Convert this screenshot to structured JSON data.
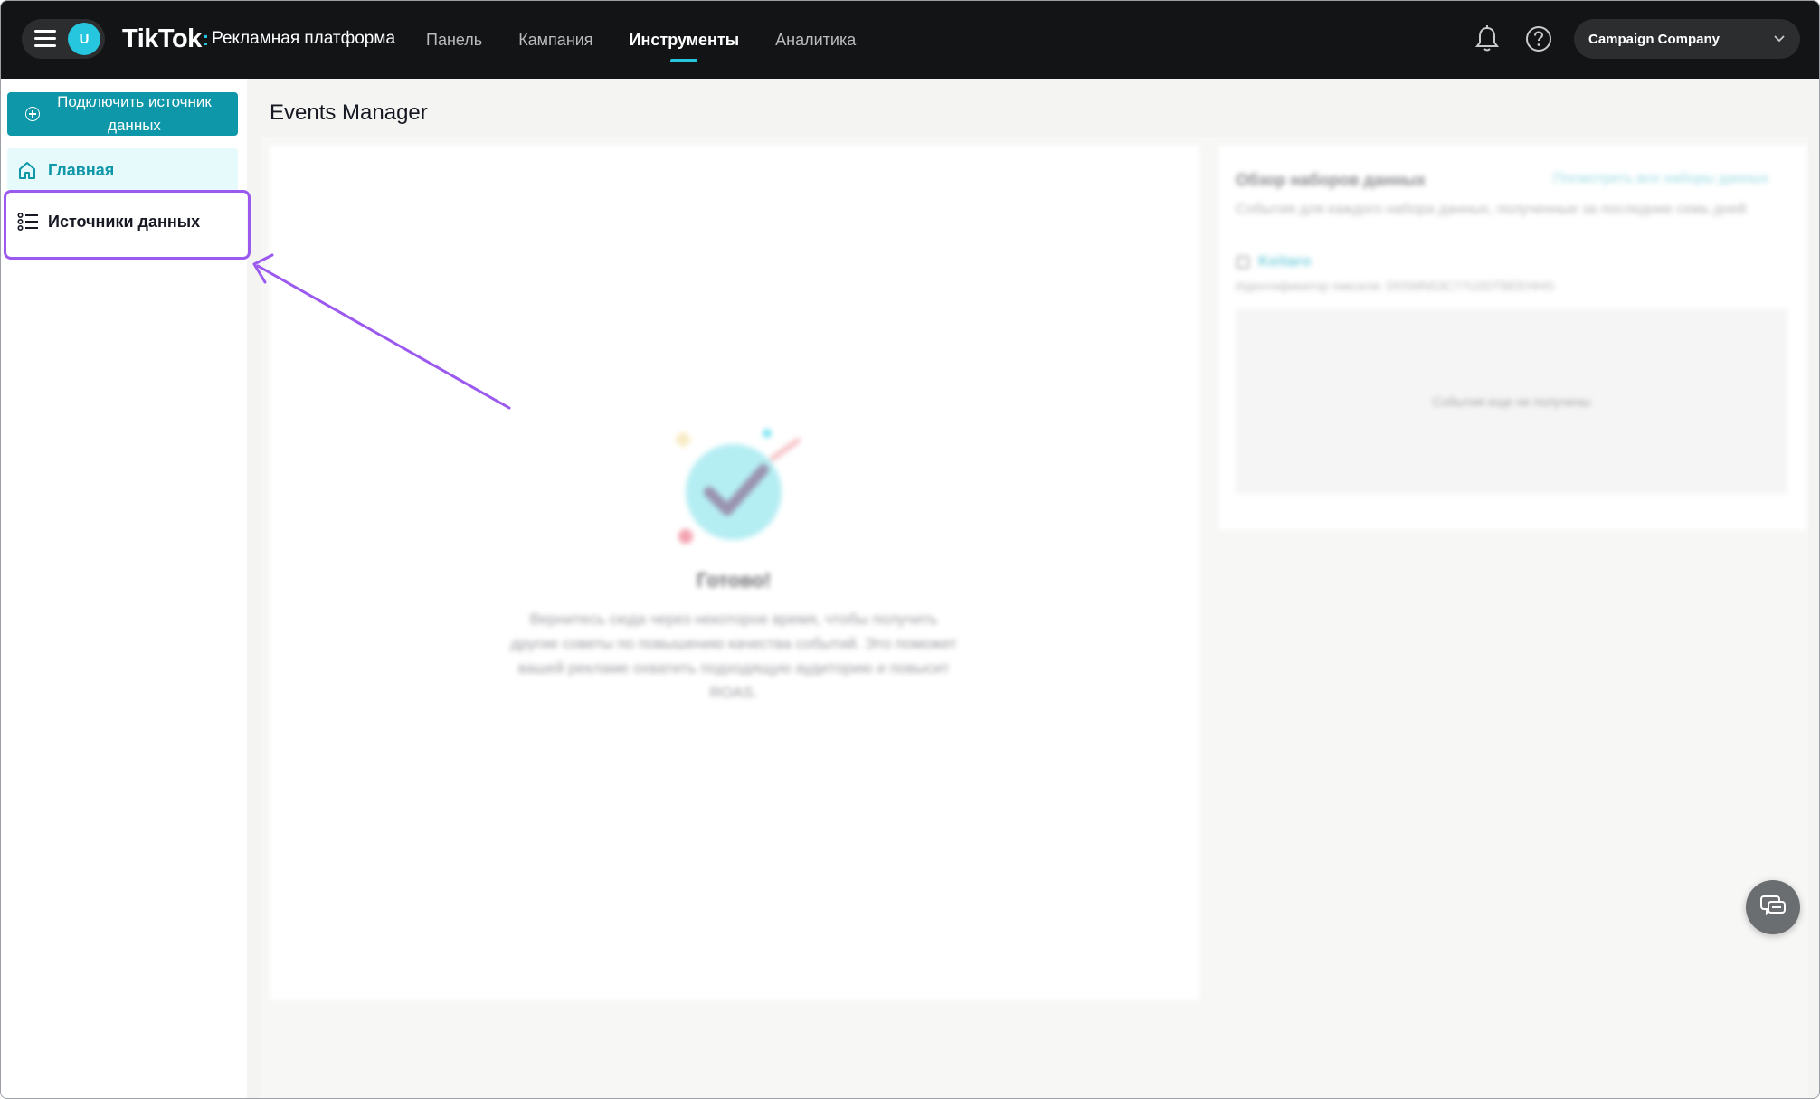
{
  "topbar": {
    "avatar_initial": "U",
    "brand": "TikTok",
    "brand_sub": "Рекламная платформа",
    "nav": [
      {
        "label": "Панель",
        "active": false
      },
      {
        "label": "Кампания",
        "active": false
      },
      {
        "label": "Инструменты",
        "active": true
      },
      {
        "label": "Аналитика",
        "active": false
      }
    ],
    "account_name": "Campaign Company",
    "icons": [
      "menu-icon",
      "bell-icon",
      "help-icon",
      "chevron-down-icon"
    ]
  },
  "sidebar": {
    "connect_button": "Подключить источник данных",
    "items": [
      {
        "label": "Главная",
        "icon": "home-icon",
        "selected": true
      },
      {
        "label": "Источники данных",
        "icon": "list-icon",
        "selected": false
      }
    ]
  },
  "main": {
    "title": "Events Manager",
    "done_title": "Готово!",
    "done_text": "Вернитесь сюда через некоторое время, чтобы получить другие советы по повышению качества событий. Это поможет вашей рекламе охватить подходящую аудиторию и повысит ROAS.",
    "overview": {
      "title": "Обзор наборов данных",
      "link": "Посмотреть все наборы данных",
      "subtitle": "События для каждого набора данных, полученные за последние семь дней",
      "pixel_name": "Keitaro",
      "pixel_id": "Идентификатор пикселя: D0SMN53C77U2DTBEEHHG",
      "empty": "События еще не получены"
    }
  },
  "colors": {
    "topbar_bg": "#121415",
    "accent": "#25c6de",
    "primary_button": "#0e97a8",
    "highlight": "#9b59f0"
  }
}
